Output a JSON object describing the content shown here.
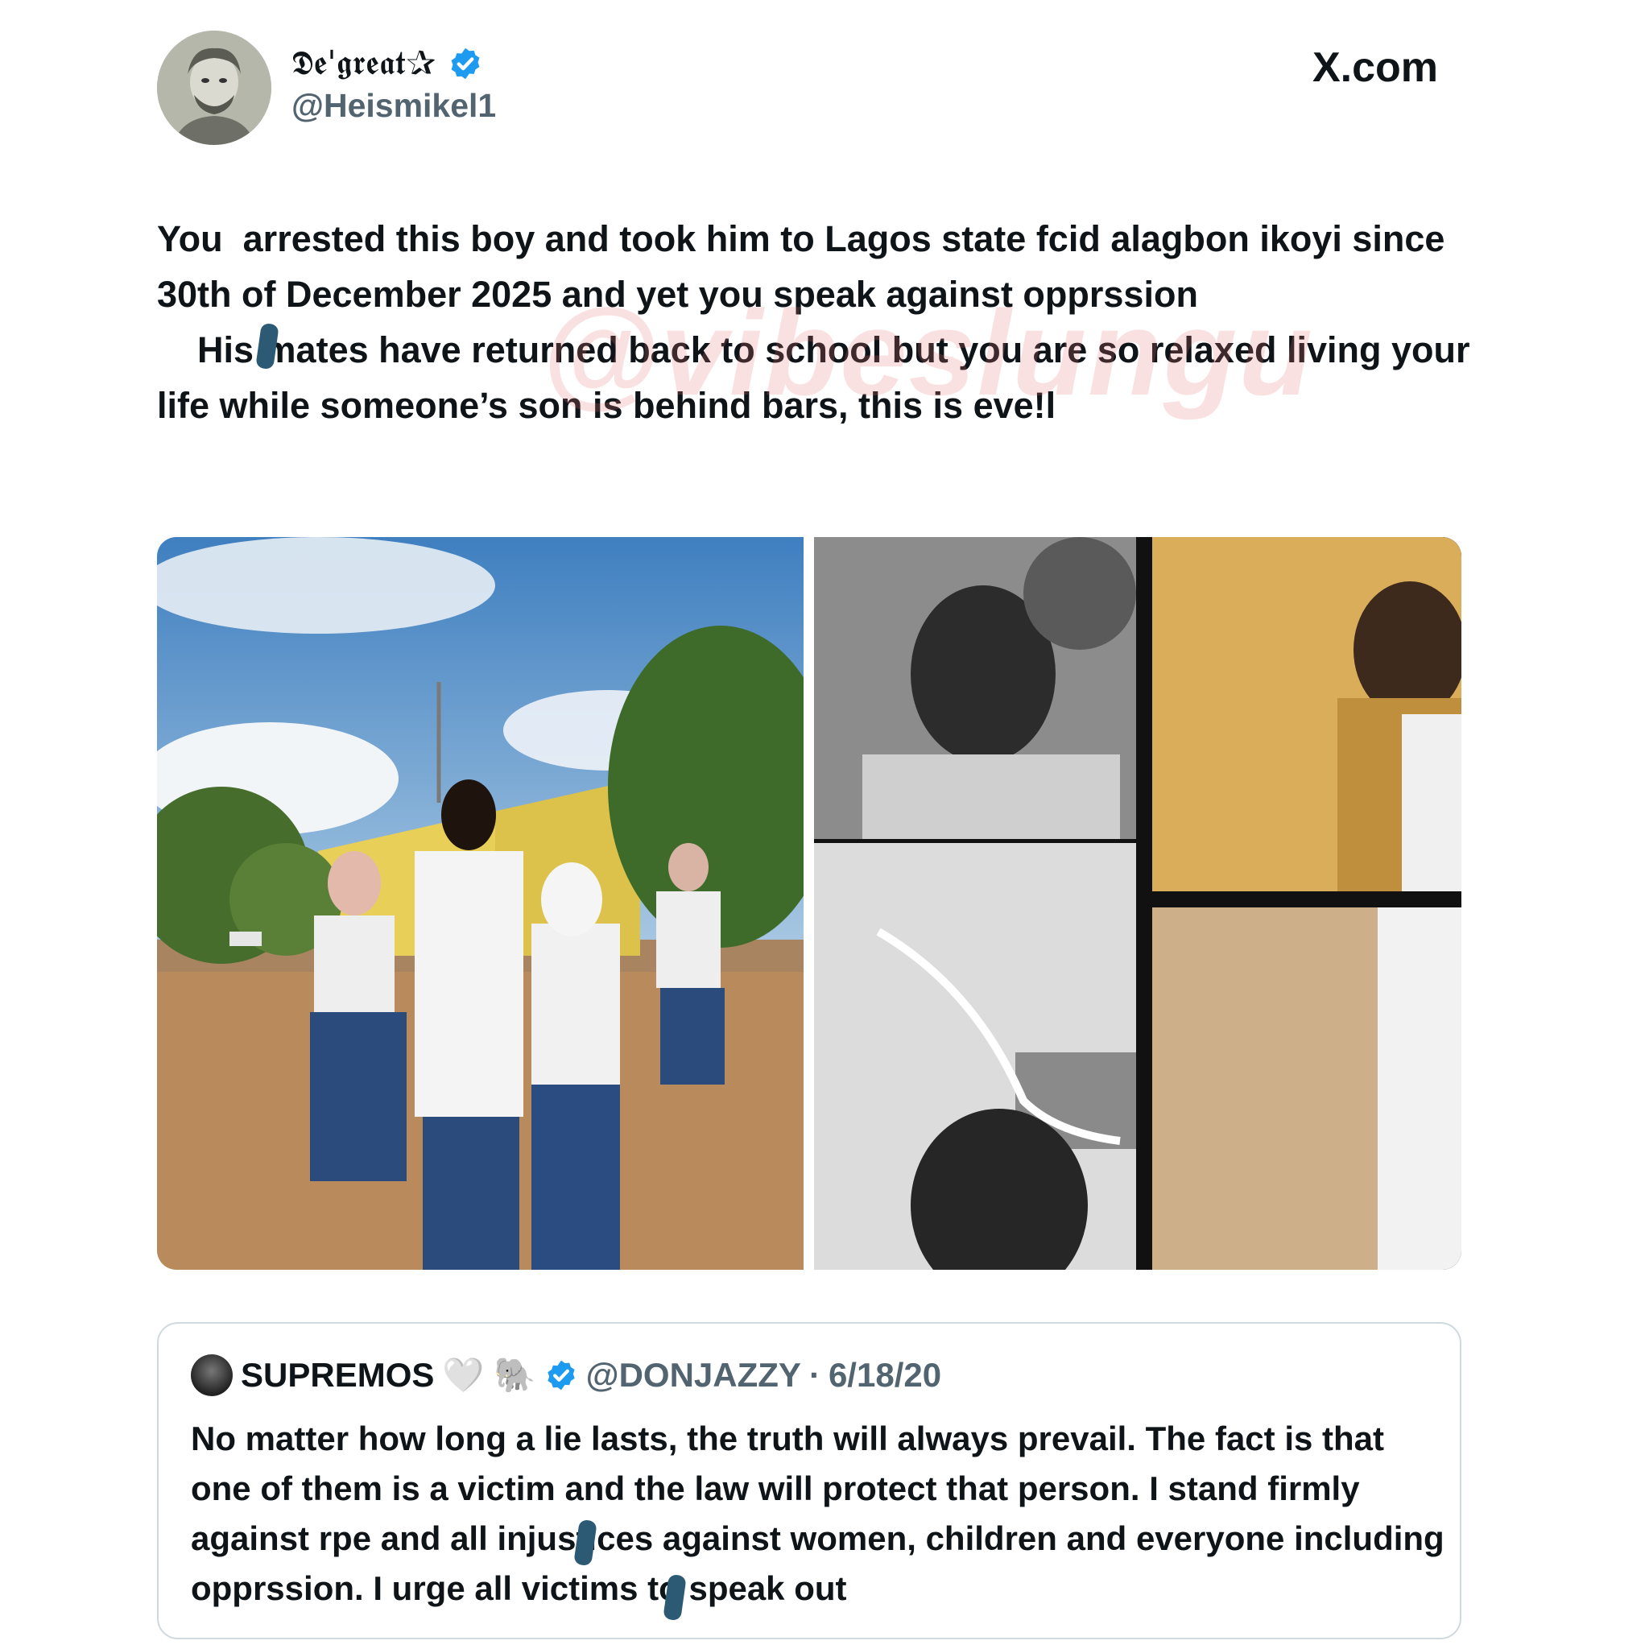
{
  "site": "X.com",
  "author": {
    "display_name": "𝕯𝖊'𝖌𝖗𝖊𝖆𝖙✰",
    "handle": "@Heismikel1",
    "verified": true
  },
  "tweet": {
    "text": "You  arrested this boy and took him to Lagos state fcid alagbon ikoyi since 30th of December 2025 and yet you speak against opprssion\n    His mates have returned back to school but you are so relaxed living your life while someone’s son is behind bars, this is eve!l"
  },
  "watermark": "@vibeslungu",
  "media": {
    "count": 2,
    "left_description": "group-photo",
    "right_description": "collage-photo"
  },
  "quote": {
    "name": "SUPREMOS",
    "emojis": "🤍 🐘",
    "verified": true,
    "handle": "@DONJAZZY",
    "separator": "·",
    "date": "6/18/20",
    "text": "No matter how long a lie lasts, the truth will always prevail. The fact is that one of them is a victim and the law will protect that person. I stand firmly against rpe and all injustices against women, children and everyone including opprssion. I urge all victims to speak out"
  },
  "colors": {
    "verified_blue": "#1d9bf0",
    "text_primary": "#0f1419",
    "text_secondary": "#536471",
    "card_border": "#cfd9de",
    "watermark": "#e87878"
  }
}
